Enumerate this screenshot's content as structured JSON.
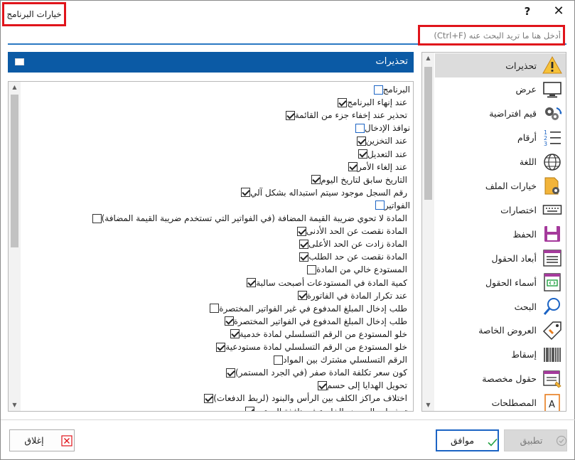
{
  "window": {
    "title": "خيارات البرنامج",
    "help_label": "?",
    "close_label": "✕"
  },
  "search": {
    "placeholder": "أدخل هنا ما تريد البحث عنه (Ctrl+F)"
  },
  "section": {
    "title": "تحذيرات"
  },
  "warnings": [
    {
      "type": "group",
      "label": "البرنامج",
      "checked": false
    },
    {
      "type": "item",
      "label": "عند إنهاء البرنامج",
      "checked": true
    },
    {
      "type": "item",
      "label": "تحذير عند إخفاء جزء من القائمة",
      "checked": true
    },
    {
      "type": "group",
      "label": "نوافذ الإدخال",
      "checked": false
    },
    {
      "type": "item",
      "label": "عند التخزين",
      "checked": true
    },
    {
      "type": "item",
      "label": "عند التعديل",
      "checked": true
    },
    {
      "type": "item",
      "label": "عند إلغاء الأمر",
      "checked": true
    },
    {
      "type": "item",
      "label": "التاريخ سابق لتاريخ اليوم",
      "checked": true
    },
    {
      "type": "item",
      "label": "رقم السجل موجود سيتم استبداله بشكل آلي",
      "checked": true
    },
    {
      "type": "group",
      "label": "الفواتير",
      "checked": false
    },
    {
      "type": "item",
      "label": "المادة لا تحوي ضريبة القيمة المضافة (في الفواتير التي تستخدم ضريبة القيمة المضافة)",
      "checked": false
    },
    {
      "type": "item",
      "label": "المادة نقصت عن الحد الأدنى",
      "checked": true
    },
    {
      "type": "item",
      "label": "المادة زادت عن الحد الأعلى",
      "checked": true
    },
    {
      "type": "item",
      "label": "المادة نقصت عن حد الطلب",
      "checked": true
    },
    {
      "type": "item",
      "label": "المستودع خالي من المادة",
      "checked": false
    },
    {
      "type": "item",
      "label": "كمية المادة في المستودعات أصبحت سالبة",
      "checked": true
    },
    {
      "type": "item",
      "label": "عند تكرار المادة في الفاتورة",
      "checked": true
    },
    {
      "type": "item",
      "label": "طلب إدخال المبلغ المدفوع في غير الفواتير المختصرة",
      "checked": false
    },
    {
      "type": "item",
      "label": "طلب إدخال المبلغ المدفوع في الفواتير المختصرة",
      "checked": true
    },
    {
      "type": "item",
      "label": "خلو المستودع من الرقم التسلسلي لمادة خدمية",
      "checked": true
    },
    {
      "type": "item",
      "label": "خلو المستودع من الرقم التسلسلي لمادة مستودعية",
      "checked": true
    },
    {
      "type": "item",
      "label": "الرقم التسلسلي مشترك بين المواد",
      "checked": false
    },
    {
      "type": "item",
      "label": "كون سعر تكلفة المادة صفر (في الجرد المستمر)",
      "checked": true
    },
    {
      "type": "item",
      "label": "تحويل الهدايا إلى حسم",
      "checked": true
    },
    {
      "type": "item",
      "label": "اختلاف مراكز الكلف بين الرأس والبنود (لربط الدفعات)",
      "checked": true
    },
    {
      "type": "item",
      "label": "تحذيرات العروض الخاصة في نافذة المرتجع",
      "checked": true
    }
  ],
  "nav": [
    {
      "label": "تحذيرات",
      "icon": "warning-icon",
      "active": true
    },
    {
      "label": "عرض",
      "icon": "monitor-icon",
      "active": false
    },
    {
      "label": "قيم افتراضية",
      "icon": "gears-refresh-icon",
      "active": false
    },
    {
      "label": "أرقام",
      "icon": "numbered-list-icon",
      "active": false
    },
    {
      "label": "اللغة",
      "icon": "globe-icon",
      "active": false
    },
    {
      "label": "خيارات الملف",
      "icon": "file-settings-icon",
      "active": false
    },
    {
      "label": "اختصارات",
      "icon": "keyboard-icon",
      "active": false
    },
    {
      "label": "الحفظ",
      "icon": "save-disk-icon",
      "active": false
    },
    {
      "label": "أبعاد الحقول",
      "icon": "field-dimensions-icon",
      "active": false
    },
    {
      "label": "أسماء الحقول",
      "icon": "field-names-icon",
      "active": false
    },
    {
      "label": "البحث",
      "icon": "magnifier-icon",
      "active": false
    },
    {
      "label": "العروض الخاصة",
      "icon": "tag-offer-icon",
      "active": false
    },
    {
      "label": "إسقاط",
      "icon": "barcode-icon",
      "active": false
    },
    {
      "label": "حقول مخصصة",
      "icon": "custom-fields-icon",
      "active": false
    },
    {
      "label": "المصطلحات",
      "icon": "terms-book-icon",
      "active": false
    }
  ],
  "buttons": {
    "apply": "تطبيق",
    "ok": "موافق",
    "close": "إغلاق"
  },
  "colors": {
    "accent": "#0b5aa5",
    "highlight": "#e0141b",
    "selection": "#dcdcdc"
  }
}
